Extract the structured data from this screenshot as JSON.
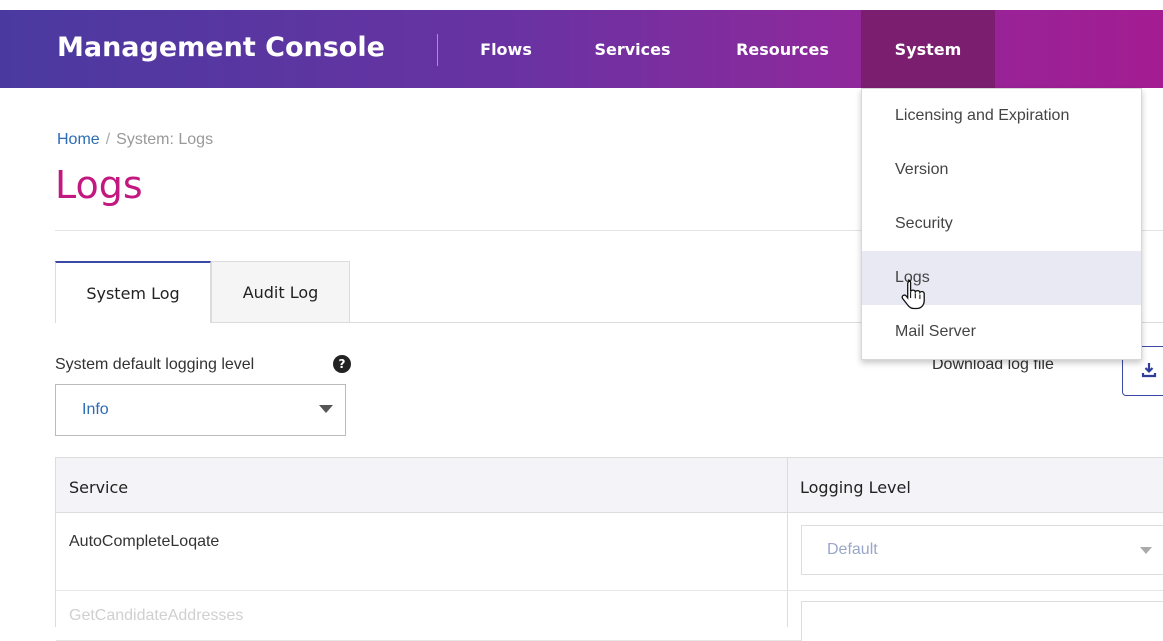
{
  "header": {
    "brand": "Management Console",
    "nav": [
      "Flows",
      "Services",
      "Resources",
      "System"
    ],
    "active_nav": "System"
  },
  "system_menu": {
    "items": [
      "Licensing and Expiration",
      "Version",
      "Security",
      "Logs",
      "Mail Server"
    ],
    "highlighted": "Logs"
  },
  "breadcrumb": {
    "home": "Home",
    "separator": "/",
    "current": "System: Logs"
  },
  "page": {
    "title": "Logs"
  },
  "tabs": {
    "items": [
      "System Log",
      "Audit Log"
    ],
    "active": "System Log"
  },
  "logging": {
    "default_label": "System default logging level",
    "default_value": "Info",
    "help_icon": "question-circle-icon",
    "download_label": "Download log file",
    "download_icon": "download-icon"
  },
  "table": {
    "headers": [
      "Service",
      "Logging Level"
    ],
    "rows": [
      {
        "service": "AutoCompleteLoqate",
        "level": "Default"
      },
      {
        "service": "GetCandidateAddresses",
        "level": ""
      }
    ]
  },
  "colors": {
    "accent": "#c2187f",
    "nav_active": "#7b1e70",
    "link": "#2b6cb5"
  }
}
